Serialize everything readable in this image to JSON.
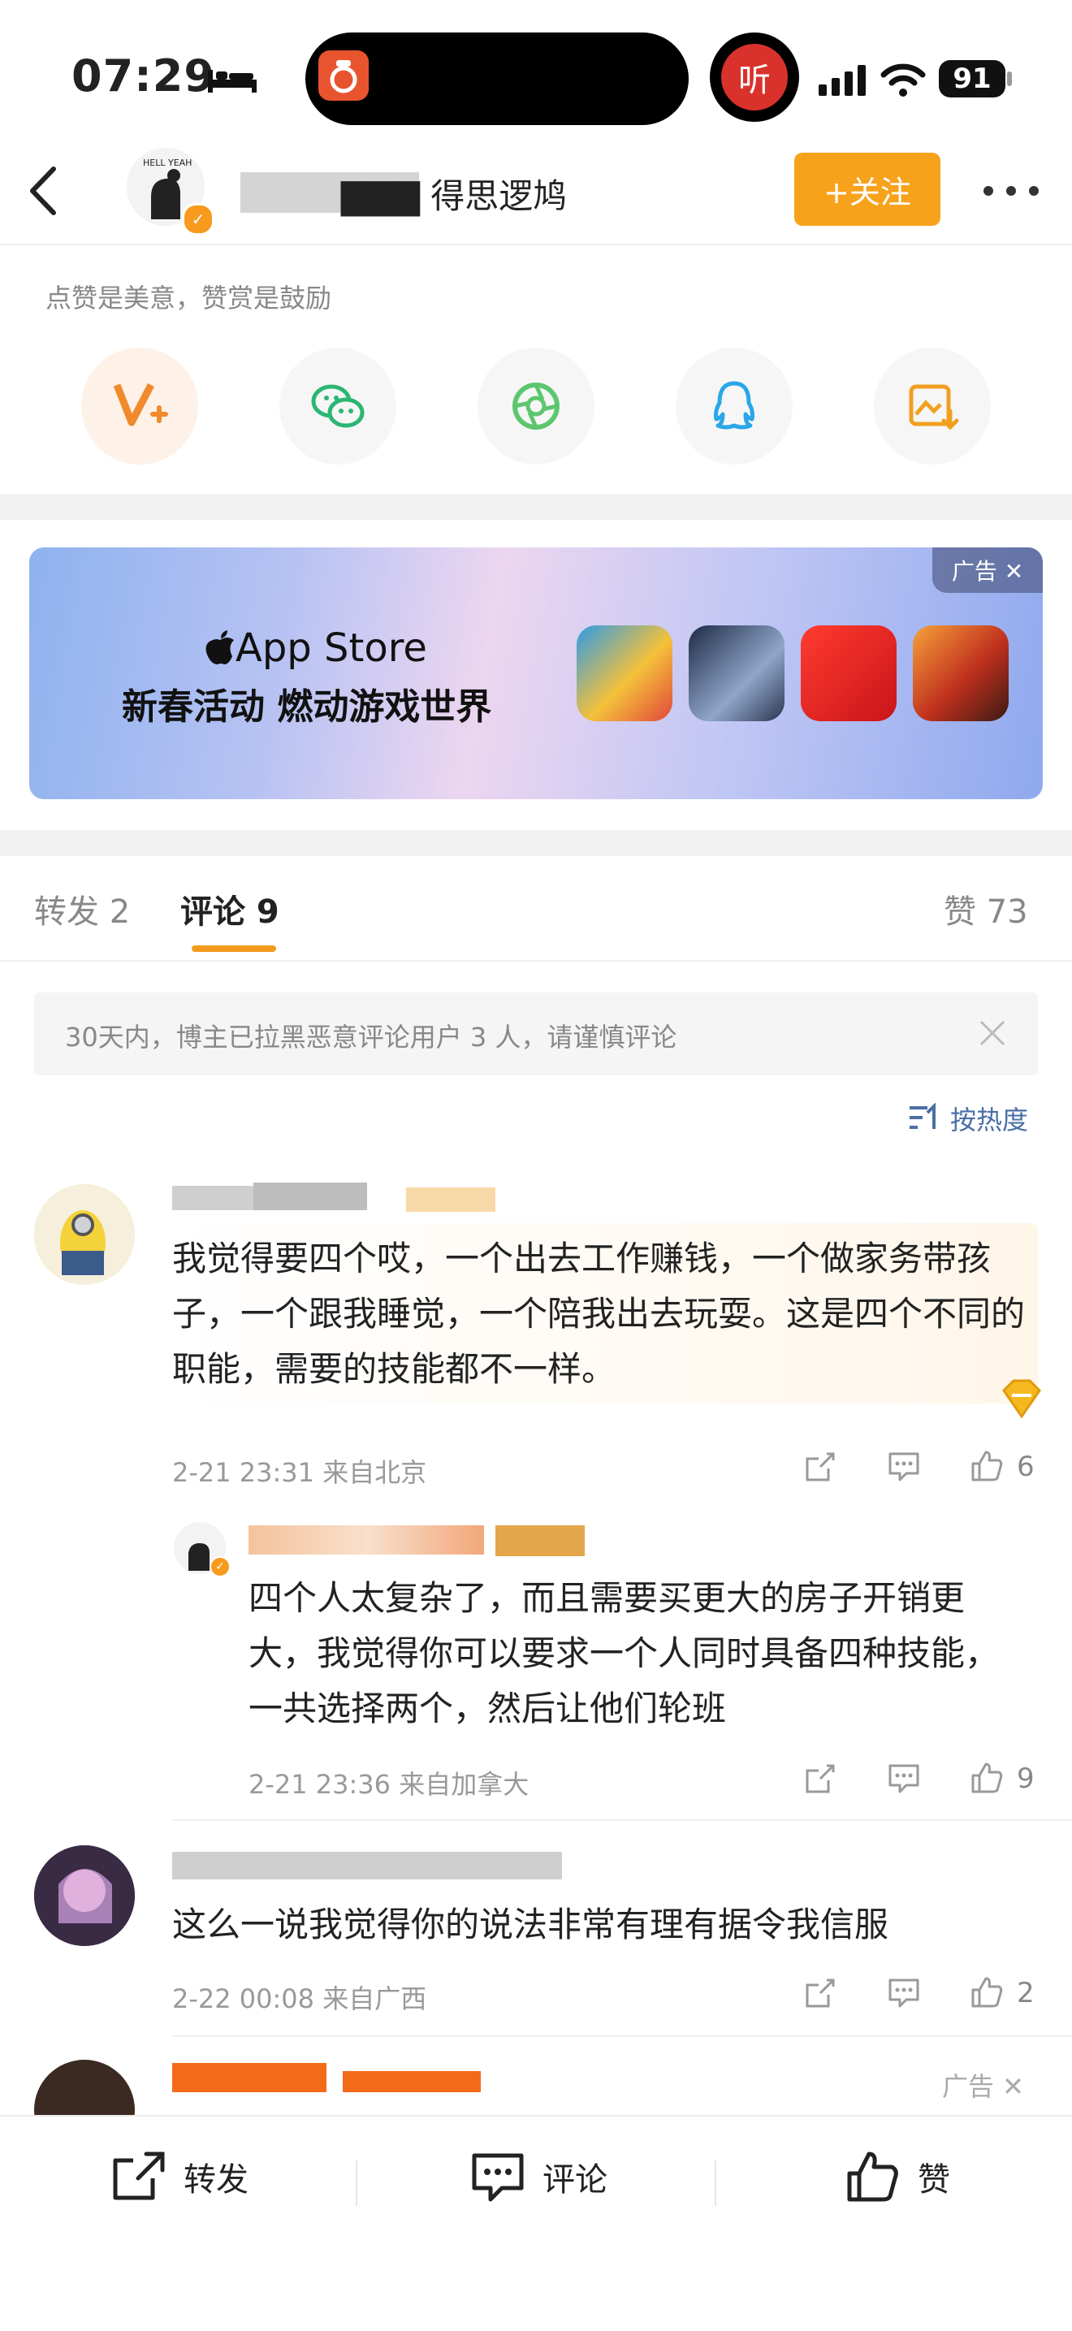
{
  "status_bar": {
    "time": "07:29",
    "listen_label": "听",
    "battery": "91"
  },
  "nav": {
    "user_name": "▇▇▇ 得思逻鸠",
    "follow_label": "+关注",
    "verify_mark": "✓"
  },
  "share_panel": {
    "hint": "点赞是美意，赞赏是鼓励",
    "items": [
      "V+",
      "wechat-icon",
      "moments-icon",
      "qq-icon",
      "save-image-icon"
    ]
  },
  "ad_banner": {
    "tag": "广告 ✕",
    "brand": "App Store",
    "title": "新春活动 燃动游戏世界"
  },
  "tabs": {
    "repost": "转发 2",
    "comment": "评论 9",
    "like": "赞 73"
  },
  "notice": {
    "text": "30天内，博主已拉黑恶意评论用户 3 人，请谨慎评论"
  },
  "sort_label": "按热度",
  "comments": [
    {
      "text": "我觉得要四个哎，一个出去工作赚钱，一个做家务带孩子，一个跟我睡觉，一个陪我出去玩耍。这是四个不同的职能，需要的技能都不一样。",
      "meta": "2-21 23:31 来自北京",
      "likes": "6"
    },
    {
      "text": "四个人太复杂了，而且需要买更大的房子开销更大，我觉得你可以要求一个人同时具备四种技能，一共选择两个，然后让他们轮班",
      "meta": "2-21 23:36 来自加拿大",
      "likes": "9"
    },
    {
      "text": "这么一说我觉得你的说法非常有理有据令我信服",
      "meta": "2-22 00:08 来自广西",
      "likes": "2"
    }
  ],
  "ad_comment_tag": "广告 ✕",
  "bottom_bar": {
    "repost": "转发",
    "comment": "评论",
    "like": "赞"
  },
  "colors": {
    "accent_orange": "#f7a21b",
    "link_blue": "#4a6fa5",
    "wechat_green": "#2bb673",
    "qq_blue": "#2aa7e8"
  }
}
